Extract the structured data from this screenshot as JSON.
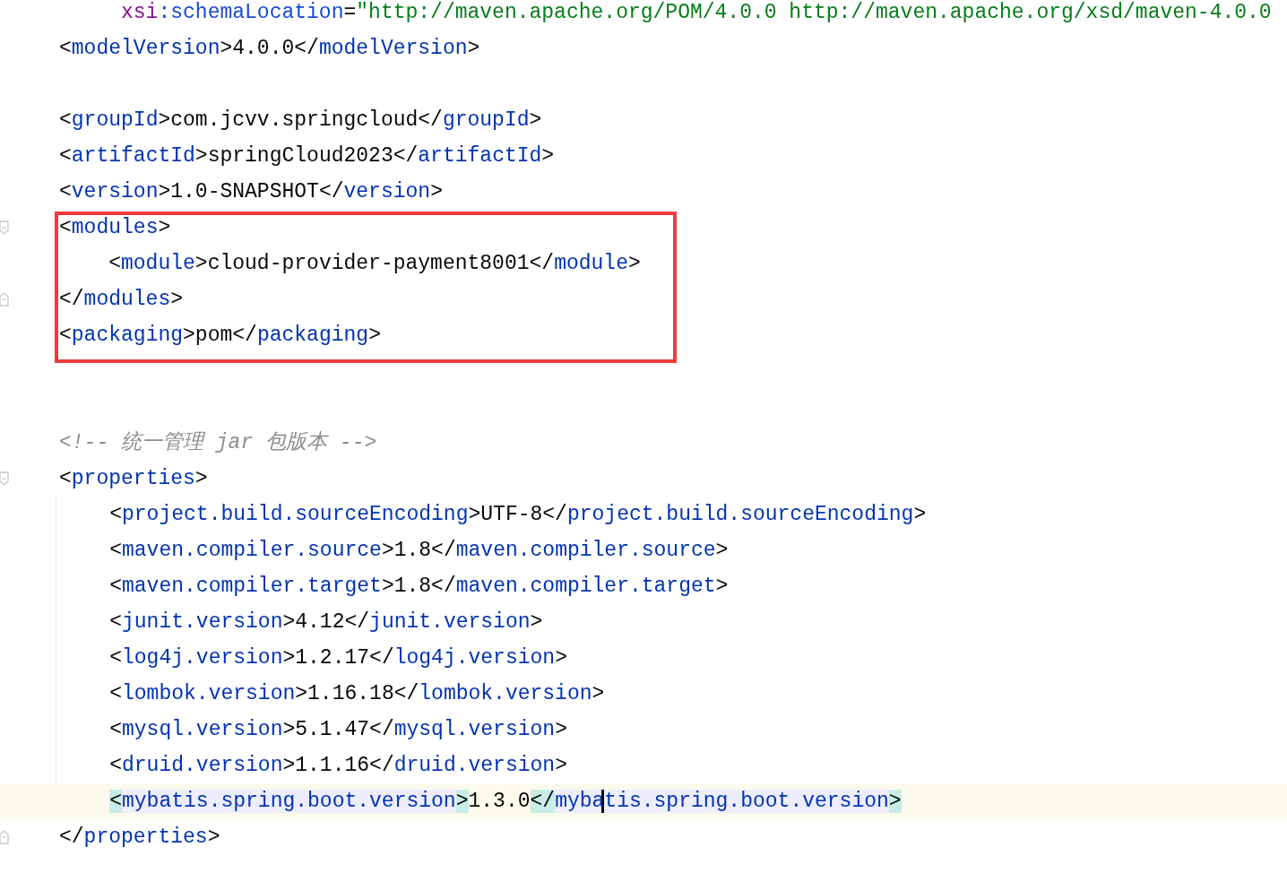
{
  "editor": {
    "blocks": [
      {
        "kind": "plain",
        "lines": [
          {
            "kind": "continuation",
            "tokens": [
              {
                "kind": "attr-ns",
                "text": "xsi"
              },
              {
                "kind": "attr",
                "text": ":schemaLocation"
              },
              {
                "kind": "punct",
                "text": "="
              },
              {
                "kind": "value",
                "text": "\"http://maven.apache.org/POM/4.0.0 http://maven.apache.org/xsd/maven-4.0.0"
              }
            ]
          },
          {
            "kind": "code",
            "tokens": [
              {
                "kind": "punct",
                "text": "<"
              },
              {
                "kind": "tag",
                "text": "modelVersion"
              },
              {
                "kind": "punct",
                "text": ">"
              },
              {
                "kind": "text",
                "text": "4.0.0"
              },
              {
                "kind": "punct",
                "text": "</"
              },
              {
                "kind": "tag",
                "text": "modelVersion"
              },
              {
                "kind": "punct",
                "text": ">"
              }
            ]
          },
          {
            "kind": "blank"
          },
          {
            "kind": "code",
            "tokens": [
              {
                "kind": "punct",
                "text": "<"
              },
              {
                "kind": "tag",
                "text": "groupId"
              },
              {
                "kind": "punct",
                "text": ">"
              },
              {
                "kind": "text",
                "text": "com.jcvv.springcloud"
              },
              {
                "kind": "punct",
                "text": "</"
              },
              {
                "kind": "tag",
                "text": "groupId"
              },
              {
                "kind": "punct",
                "text": ">"
              }
            ]
          },
          {
            "kind": "code",
            "tokens": [
              {
                "kind": "punct",
                "text": "<"
              },
              {
                "kind": "tag",
                "text": "artifactId"
              },
              {
                "kind": "punct",
                "text": ">"
              },
              {
                "kind": "text",
                "text": "springCloud2023"
              },
              {
                "kind": "punct",
                "text": "</"
              },
              {
                "kind": "tag",
                "text": "artifactId"
              },
              {
                "kind": "punct",
                "text": ">"
              }
            ]
          },
          {
            "kind": "code",
            "tokens": [
              {
                "kind": "punct",
                "text": "<"
              },
              {
                "kind": "tag",
                "text": "version"
              },
              {
                "kind": "punct",
                "text": ">"
              },
              {
                "kind": "text",
                "text": "1.0-SNAPSHOT"
              },
              {
                "kind": "punct",
                "text": "</"
              },
              {
                "kind": "tag",
                "text": "version"
              },
              {
                "kind": "punct",
                "text": ">"
              }
            ]
          }
        ]
      },
      {
        "kind": "boxed",
        "lines": [
          {
            "kind": "code",
            "fold_start": true,
            "tokens": [
              {
                "kind": "punct",
                "text": "<"
              },
              {
                "kind": "tag",
                "text": "modules"
              },
              {
                "kind": "punct",
                "text": ">"
              }
            ],
            "children": [
              {
                "kind": "code",
                "tokens": [
                  {
                    "kind": "punct",
                    "text": "<"
                  },
                  {
                    "kind": "tag",
                    "text": "module"
                  },
                  {
                    "kind": "punct",
                    "text": ">"
                  },
                  {
                    "kind": "text",
                    "text": "cloud-provider-payment8001"
                  },
                  {
                    "kind": "punct",
                    "text": "</"
                  },
                  {
                    "kind": "tag",
                    "text": "module"
                  },
                  {
                    "kind": "punct",
                    "text": ">"
                  }
                ]
              }
            ]
          },
          {
            "kind": "code",
            "fold_end": true,
            "tokens": [
              {
                "kind": "punct",
                "text": "</"
              },
              {
                "kind": "tag",
                "text": "modules"
              },
              {
                "kind": "punct",
                "text": ">"
              }
            ]
          },
          {
            "kind": "code",
            "tokens": [
              {
                "kind": "punct",
                "text": "<"
              },
              {
                "kind": "tag",
                "text": "packaging"
              },
              {
                "kind": "punct",
                "text": ">"
              },
              {
                "kind": "text",
                "text": "pom"
              },
              {
                "kind": "punct",
                "text": "</"
              },
              {
                "kind": "tag",
                "text": "packaging"
              },
              {
                "kind": "punct",
                "text": ">"
              }
            ]
          }
        ]
      },
      {
        "kind": "plain",
        "lines": [
          {
            "kind": "blank"
          },
          {
            "kind": "blank"
          },
          {
            "kind": "code",
            "tokens": [
              {
                "kind": "comment",
                "text": "<!-- 统一管理 jar 包版本 -->"
              }
            ]
          },
          {
            "kind": "code",
            "fold_start": true,
            "tokens": [
              {
                "kind": "punct",
                "text": "<"
              },
              {
                "kind": "tag",
                "text": "properties"
              },
              {
                "kind": "punct",
                "text": ">"
              }
            ],
            "children": [
              {
                "kind": "code",
                "tokens": [
                  {
                    "kind": "punct",
                    "text": "<"
                  },
                  {
                    "kind": "tag",
                    "text": "project.build.sourceEncoding"
                  },
                  {
                    "kind": "punct",
                    "text": ">"
                  },
                  {
                    "kind": "text",
                    "text": "UTF-8"
                  },
                  {
                    "kind": "punct",
                    "text": "</"
                  },
                  {
                    "kind": "tag",
                    "text": "project.build.sourceEncoding"
                  },
                  {
                    "kind": "punct",
                    "text": ">"
                  }
                ]
              },
              {
                "kind": "code",
                "tokens": [
                  {
                    "kind": "punct",
                    "text": "<"
                  },
                  {
                    "kind": "tag",
                    "text": "maven.compiler.source"
                  },
                  {
                    "kind": "punct",
                    "text": ">"
                  },
                  {
                    "kind": "text",
                    "text": "1.8"
                  },
                  {
                    "kind": "punct",
                    "text": "</"
                  },
                  {
                    "kind": "tag",
                    "text": "maven.compiler.source"
                  },
                  {
                    "kind": "punct",
                    "text": ">"
                  }
                ]
              },
              {
                "kind": "code",
                "tokens": [
                  {
                    "kind": "punct",
                    "text": "<"
                  },
                  {
                    "kind": "tag",
                    "text": "maven.compiler.target"
                  },
                  {
                    "kind": "punct",
                    "text": ">"
                  },
                  {
                    "kind": "text",
                    "text": "1.8"
                  },
                  {
                    "kind": "punct",
                    "text": "</"
                  },
                  {
                    "kind": "tag",
                    "text": "maven.compiler.target"
                  },
                  {
                    "kind": "punct",
                    "text": ">"
                  }
                ]
              },
              {
                "kind": "code",
                "tokens": [
                  {
                    "kind": "punct",
                    "text": "<"
                  },
                  {
                    "kind": "tag",
                    "text": "junit.version"
                  },
                  {
                    "kind": "punct",
                    "text": ">"
                  },
                  {
                    "kind": "text",
                    "text": "4.12"
                  },
                  {
                    "kind": "punct",
                    "text": "</"
                  },
                  {
                    "kind": "tag",
                    "text": "junit.version"
                  },
                  {
                    "kind": "punct",
                    "text": ">"
                  }
                ]
              },
              {
                "kind": "code",
                "tokens": [
                  {
                    "kind": "punct",
                    "text": "<"
                  },
                  {
                    "kind": "tag",
                    "text": "log4j.version"
                  },
                  {
                    "kind": "punct",
                    "text": ">"
                  },
                  {
                    "kind": "text",
                    "text": "1.2.17"
                  },
                  {
                    "kind": "punct",
                    "text": "</"
                  },
                  {
                    "kind": "tag",
                    "text": "log4j.version"
                  },
                  {
                    "kind": "punct",
                    "text": ">"
                  }
                ]
              },
              {
                "kind": "code",
                "tokens": [
                  {
                    "kind": "punct",
                    "text": "<"
                  },
                  {
                    "kind": "tag",
                    "text": "lombok.version"
                  },
                  {
                    "kind": "punct",
                    "text": ">"
                  },
                  {
                    "kind": "text",
                    "text": "1.16.18"
                  },
                  {
                    "kind": "punct",
                    "text": "</"
                  },
                  {
                    "kind": "tag",
                    "text": "lombok.version"
                  },
                  {
                    "kind": "punct",
                    "text": ">"
                  }
                ]
              },
              {
                "kind": "code",
                "tokens": [
                  {
                    "kind": "punct",
                    "text": "<"
                  },
                  {
                    "kind": "tag",
                    "text": "mysql.version"
                  },
                  {
                    "kind": "punct",
                    "text": ">"
                  },
                  {
                    "kind": "text",
                    "text": "5.1.47"
                  },
                  {
                    "kind": "punct",
                    "text": "</"
                  },
                  {
                    "kind": "tag",
                    "text": "mysql.version"
                  },
                  {
                    "kind": "punct",
                    "text": ">"
                  }
                ]
              },
              {
                "kind": "code",
                "tokens": [
                  {
                    "kind": "punct",
                    "text": "<"
                  },
                  {
                    "kind": "tag",
                    "text": "druid.version"
                  },
                  {
                    "kind": "punct",
                    "text": ">"
                  },
                  {
                    "kind": "text",
                    "text": "1.1.16"
                  },
                  {
                    "kind": "punct",
                    "text": "</"
                  },
                  {
                    "kind": "tag",
                    "text": "druid.version"
                  },
                  {
                    "kind": "punct",
                    "text": ">"
                  }
                ]
              },
              {
                "kind": "code",
                "current": true,
                "tokens": [
                  {
                    "kind": "punct",
                    "text": "<",
                    "matched": true
                  },
                  {
                    "kind": "tag",
                    "text": "mybatis.spring.boot.version",
                    "matched": true
                  },
                  {
                    "kind": "punct",
                    "text": ">",
                    "matched": true
                  },
                  {
                    "kind": "text",
                    "text": "1.3.0"
                  },
                  {
                    "kind": "punct",
                    "text": "</",
                    "matched": true
                  },
                  {
                    "kind": "tag",
                    "text": "myba",
                    "matched": true,
                    "caret": true
                  },
                  {
                    "kind": "tag",
                    "text": "tis.spring.boot.version",
                    "matched": true
                  },
                  {
                    "kind": "punct",
                    "text": ">",
                    "matched": true
                  }
                ]
              }
            ]
          },
          {
            "kind": "code",
            "fold_end": true,
            "tokens": [
              {
                "kind": "punct",
                "text": "</"
              },
              {
                "kind": "tag",
                "text": "properties"
              },
              {
                "kind": "punct",
                "text": ">"
              }
            ]
          }
        ]
      }
    ]
  }
}
